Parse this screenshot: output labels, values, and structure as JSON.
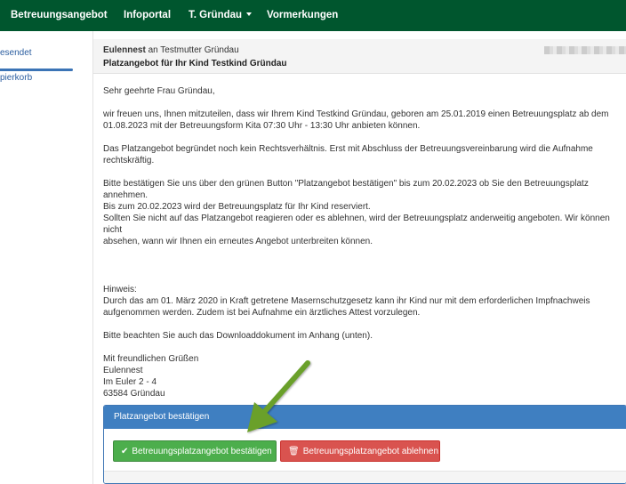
{
  "nav": {
    "items": [
      {
        "label": "Betreuungsangebot"
      },
      {
        "label": "Infoportal"
      },
      {
        "label": "T. Gründau"
      },
      {
        "label": "Vormerkungen"
      }
    ]
  },
  "sidebar": {
    "items": [
      {
        "label": "esendet"
      },
      {
        "label": "pierkorb"
      }
    ]
  },
  "message": {
    "sender": "Eulennest",
    "to_text": " an Testmutter Gründau",
    "subject": "Platzangebot für Ihr Kind Testkind Gründau"
  },
  "body": {
    "paragraphs": [
      "Sehr geehrte Frau Gründau,",
      "wir freuen uns, Ihnen mitzuteilen, dass wir Ihrem Kind Testkind Gründau, geboren am 25.01.2019 einen Betreuungsplatz ab dem\n01.08.2023 mit der Betreuungsform Kita 07:30 Uhr - 13:30 Uhr anbieten können.",
      "Das Platzangebot begründet noch kein Rechtsverhältnis. Erst mit Abschluss der Betreuungsvereinbarung wird die Aufnahme\nrechtskräftig.",
      "Bitte bestätigen Sie uns über den grünen Button \"Platzangebot bestätigen\" bis zum 20.02.2023 ob Sie den Betreuungsplatz annehmen.\nBis zum 20.02.2023 wird der Betreuungsplatz für Ihr Kind reserviert.\nSollten Sie nicht auf das Platzangebot reagieren oder es ablehnen, wird der Betreuungsplatz anderweitig angeboten. Wir können nicht\nabsehen, wann wir Ihnen ein erneutes Angebot unterbreiten können.",
      "Hinweis:\nDurch das am 01. März 2020 in Kraft getretene Masernschutzgesetz kann ihr Kind nur mit dem erforderlichen Impfnachweis\naufgenommen werden. Zudem ist bei Aufnahme ein ärztliches Attest vorzulegen.",
      "Bitte beachten Sie auch das Downloaddokument im Anhang (unten).",
      "Mit freundlichen Grüßen\nEulennest\nIm Euler 2 - 4\n63584 Gründau"
    ]
  },
  "panel": {
    "title": "Platzangebot bestätigen",
    "confirm_label": "Betreuungsplatzangebot bestätigen",
    "decline_label": "Betreuungsplatzangebot ablehnen",
    "confirm_icon": "check-icon",
    "decline_icon": "trash-icon"
  },
  "colors": {
    "nav_bg": "#00562e",
    "confirm": "#4cae4c",
    "decline": "#d9534f",
    "panel_head": "#3f7fc1",
    "arrow": "#6aa02b"
  }
}
